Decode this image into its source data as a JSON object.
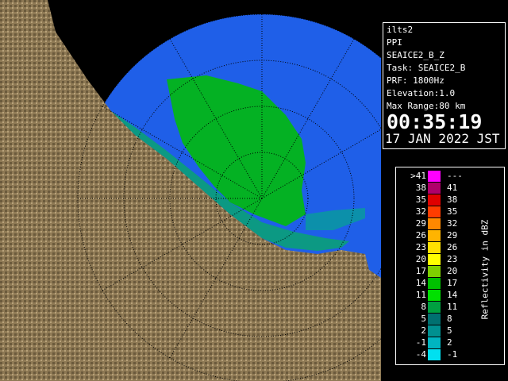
{
  "info": {
    "site": "ilts2",
    "mode": "PPI",
    "product": "SEAICE2_B_Z",
    "task": "Task: SEAICE2_B",
    "prf": "PRF: 1800Hz",
    "elevation": "Elevation:1.0",
    "max_range": "Max Range:80 km",
    "time": "00:35:19",
    "date": "17 JAN 2022 JST"
  },
  "legend": {
    "unit_label": "Reflectivity in dBZ",
    "rows": [
      {
        "lo": ">41",
        "hi": "---",
        "color": "#ff00ff"
      },
      {
        "lo": "38",
        "hi": "41",
        "color": "#b0006a"
      },
      {
        "lo": "35",
        "hi": "38",
        "color": "#e00000"
      },
      {
        "lo": "32",
        "hi": "35",
        "color": "#ff3c00"
      },
      {
        "lo": "29",
        "hi": "32",
        "color": "#ff8800"
      },
      {
        "lo": "26",
        "hi": "29",
        "color": "#ffb400"
      },
      {
        "lo": "23",
        "hi": "26",
        "color": "#ffe000"
      },
      {
        "lo": "20",
        "hi": "23",
        "color": "#ffff00"
      },
      {
        "lo": "17",
        "hi": "20",
        "color": "#7fd000"
      },
      {
        "lo": "14",
        "hi": "17",
        "color": "#00c000"
      },
      {
        "lo": "11",
        "hi": "14",
        "color": "#00e000"
      },
      {
        "lo": "8",
        "hi": "11",
        "color": "#00a040"
      },
      {
        "lo": "5",
        "hi": "8",
        "color": "#007070"
      },
      {
        "lo": "2",
        "hi": "5",
        "color": "#009090"
      },
      {
        "lo": "-1",
        "hi": "2",
        "color": "#00b4c0"
      },
      {
        "lo": "-4",
        "hi": "-1",
        "color": "#00e0f0"
      }
    ]
  },
  "colors": {
    "sea": "#2a6fe0",
    "range_circle_fill": "#1a55e8",
    "land": "#8a7550",
    "echo": "#00c000"
  }
}
